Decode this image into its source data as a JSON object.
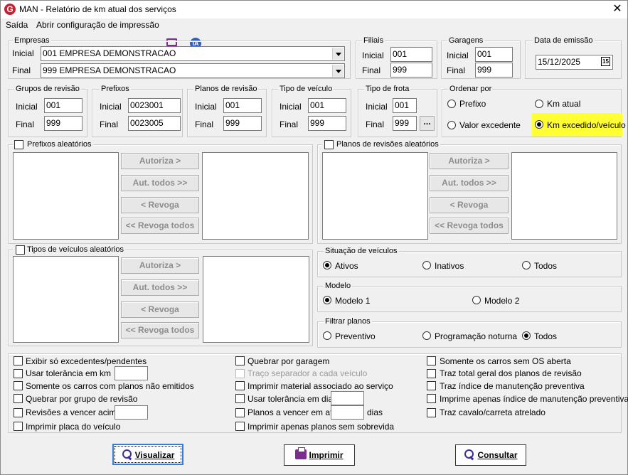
{
  "window": {
    "title": "MAN - Relatório de km atual dos serviços",
    "logo_letter": "G",
    "close": "✕"
  },
  "menu": {
    "exit": "Saída",
    "print_config": "Abrir configuração de impressão",
    "ia": "IA"
  },
  "empresas": {
    "legend": "Empresas",
    "inicial_label": "Inicial",
    "inicial_value": "001 EMPRESA DEMONSTRACAO",
    "final_label": "Final",
    "final_value": "999 EMPRESA DEMONSTRACAO"
  },
  "filiais": {
    "legend": "Filiais",
    "inicial_label": "Inicial",
    "inicial_value": "001",
    "final_label": "Final",
    "final_value": "999"
  },
  "garagens": {
    "legend": "Garagens",
    "inicial_label": "Inicial",
    "inicial_value": "001",
    "final_label": "Final",
    "final_value": "999"
  },
  "data_emissao": {
    "legend": "Data de emissão",
    "value": "15/12/2025",
    "cal_icon": "15"
  },
  "grupos": {
    "legend": "Grupos de revisão",
    "inicial_label": "Inicial",
    "inicial_value": "001",
    "final_label": "Final",
    "final_value": "999"
  },
  "prefixos": {
    "legend": "Prefixos",
    "inicial_label": "Inicial",
    "inicial_value": "0023001",
    "final_label": "Final",
    "final_value": "0023005"
  },
  "planos": {
    "legend": "Planos de revisão",
    "inicial_label": "Inicial",
    "inicial_value": "001",
    "final_label": "Final",
    "final_value": "999"
  },
  "tipo_veiculo": {
    "legend": "Tipo de veículo",
    "inicial_label": "Inicial",
    "inicial_value": "001",
    "final_label": "Final",
    "final_value": "999"
  },
  "tipo_frota": {
    "legend": "Tipo de frota",
    "inicial_label": "Inicial",
    "inicial_value": "001",
    "final_label": "Final",
    "final_value": "999",
    "more": "..."
  },
  "ordenar": {
    "legend": "Ordenar por",
    "prefixo": "Prefixo",
    "km_atual": "Km atual",
    "valor_excedente": "Valor excedente",
    "km_excedido": "Km excedido/veículo"
  },
  "transfer": {
    "autoriza": "Autoriza >",
    "aut_todos": "Aut. todos >>",
    "revoga": "< Revoga",
    "revoga_todos": "<< Revoga todos"
  },
  "prefixos_aleatorios": {
    "legend": "Prefixos aleatórios"
  },
  "planos_aleatorios": {
    "legend": "Planos de revisões aleatórios"
  },
  "tipos_aleatorios": {
    "legend": "Tipos de veículos aleatórios"
  },
  "situacao": {
    "legend": "Situação de veículos",
    "ativos": "Ativos",
    "inativos": "Inativos",
    "todos": "Todos"
  },
  "modelo": {
    "legend": "Modelo",
    "m1": "Modelo 1",
    "m2": "Modelo 2"
  },
  "filtrar": {
    "legend": "Filtrar planos",
    "preventivo": "Preventivo",
    "noturna": "Programação noturna",
    "todos": "Todos"
  },
  "options": {
    "c1": [
      "Exibir só excedentes/pendentes",
      "Usar tolerância em km",
      "Somente os carros com planos não emitidos",
      "Quebrar por grupo de revisão",
      "Revisões a vencer acima",
      "Imprimir placa do veículo"
    ],
    "c2": [
      "Quebrar por garagem",
      "Traço separador a cada veículo",
      "Imprimir material associado ao serviço",
      "Usar tolerância em dias",
      "Planos a vencer em até",
      "Imprimir apenas planos sem sobrevida"
    ],
    "c2_dias": "dias",
    "c3": [
      "Somente os carros sem OS aberta",
      "Traz total geral dos planos de revisão",
      "Traz índice de manutenção preventiva",
      "Imprime apenas índice de manutenção preventiva",
      "Traz cavalo/carreta atrelado"
    ]
  },
  "buttons": {
    "visualizar": "Visualizar",
    "imprimir": "Imprimir",
    "consultar": "Consultar"
  }
}
